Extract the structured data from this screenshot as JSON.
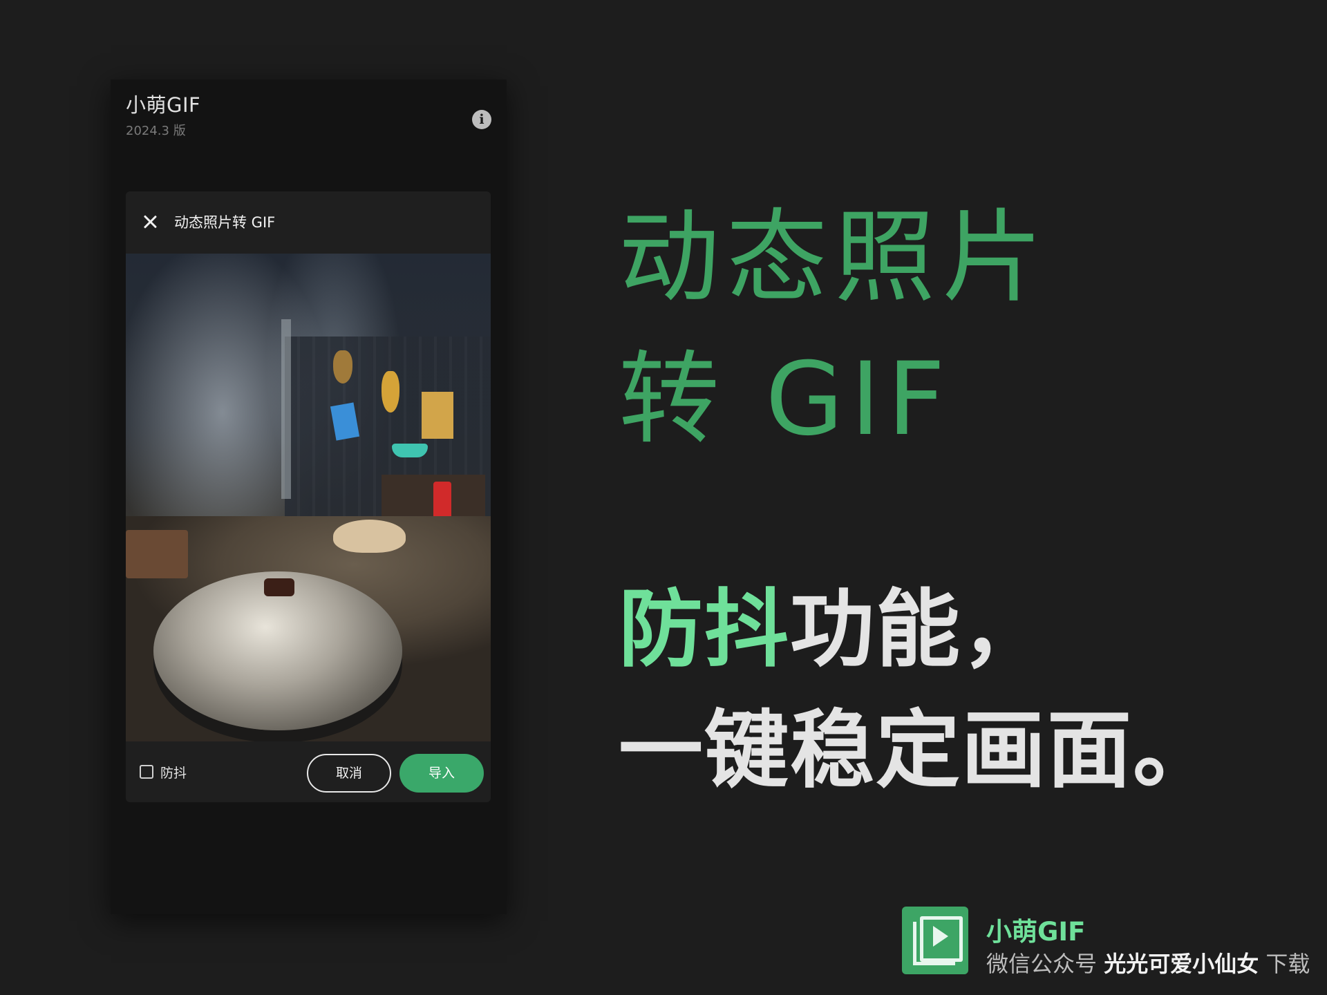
{
  "app": {
    "title": "小萌GIF",
    "version": "2024.3 版",
    "info_icon": "i"
  },
  "dialog": {
    "title": "动态照片转 GIF",
    "stabilize_label": "防抖",
    "stabilize_checked": false,
    "cancel_label": "取消",
    "import_label": "导入"
  },
  "promo": {
    "headline_line1": "动态照片",
    "headline_line2": "转 GIF",
    "tagline_accent": "防抖",
    "tagline_rest1": "功能，",
    "tagline_line2": "一键稳定画面。"
  },
  "brand": {
    "name": "小萌GIF",
    "sub_prefix": "微信公众号 ",
    "sub_account": "光光可爱小仙女",
    "sub_suffix": " 下载"
  },
  "colors": {
    "background": "#1d1d1d",
    "brand_green": "#3ea463",
    "accent_green": "#6fe09a",
    "button_green": "#3aa86a"
  }
}
